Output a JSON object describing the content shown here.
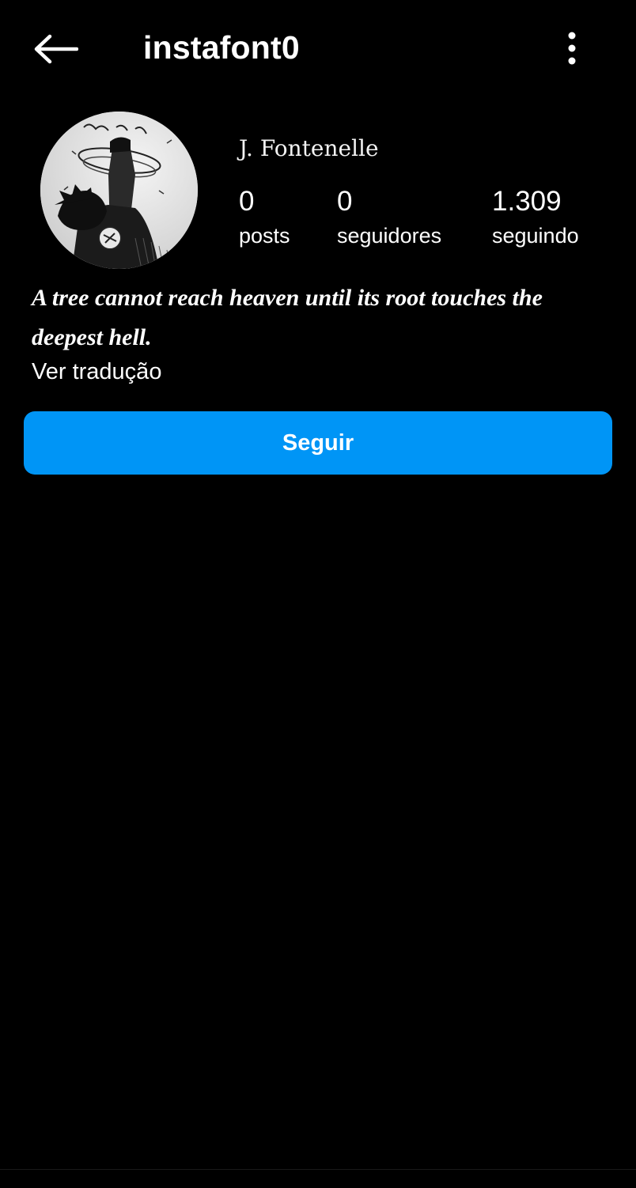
{
  "header": {
    "username": "instafont0",
    "back_icon": "arrow-left-icon",
    "more_icon": "more-vertical-icon"
  },
  "profile": {
    "display_name": "J. Fontenelle",
    "avatar_description_icon": "avatar-image",
    "stats": [
      {
        "value": "0",
        "label": "posts"
      },
      {
        "value": "0",
        "label": "seguidores"
      },
      {
        "value": "1.309",
        "label": "seguindo"
      }
    ],
    "bio": "A tree cannot reach heaven until its root touches the deepest hell.",
    "translate_label": "Ver tradução"
  },
  "actions": {
    "follow_label": "Seguir"
  },
  "colors": {
    "background": "#000000",
    "text": "#ffffff",
    "accent": "#0095f6"
  }
}
